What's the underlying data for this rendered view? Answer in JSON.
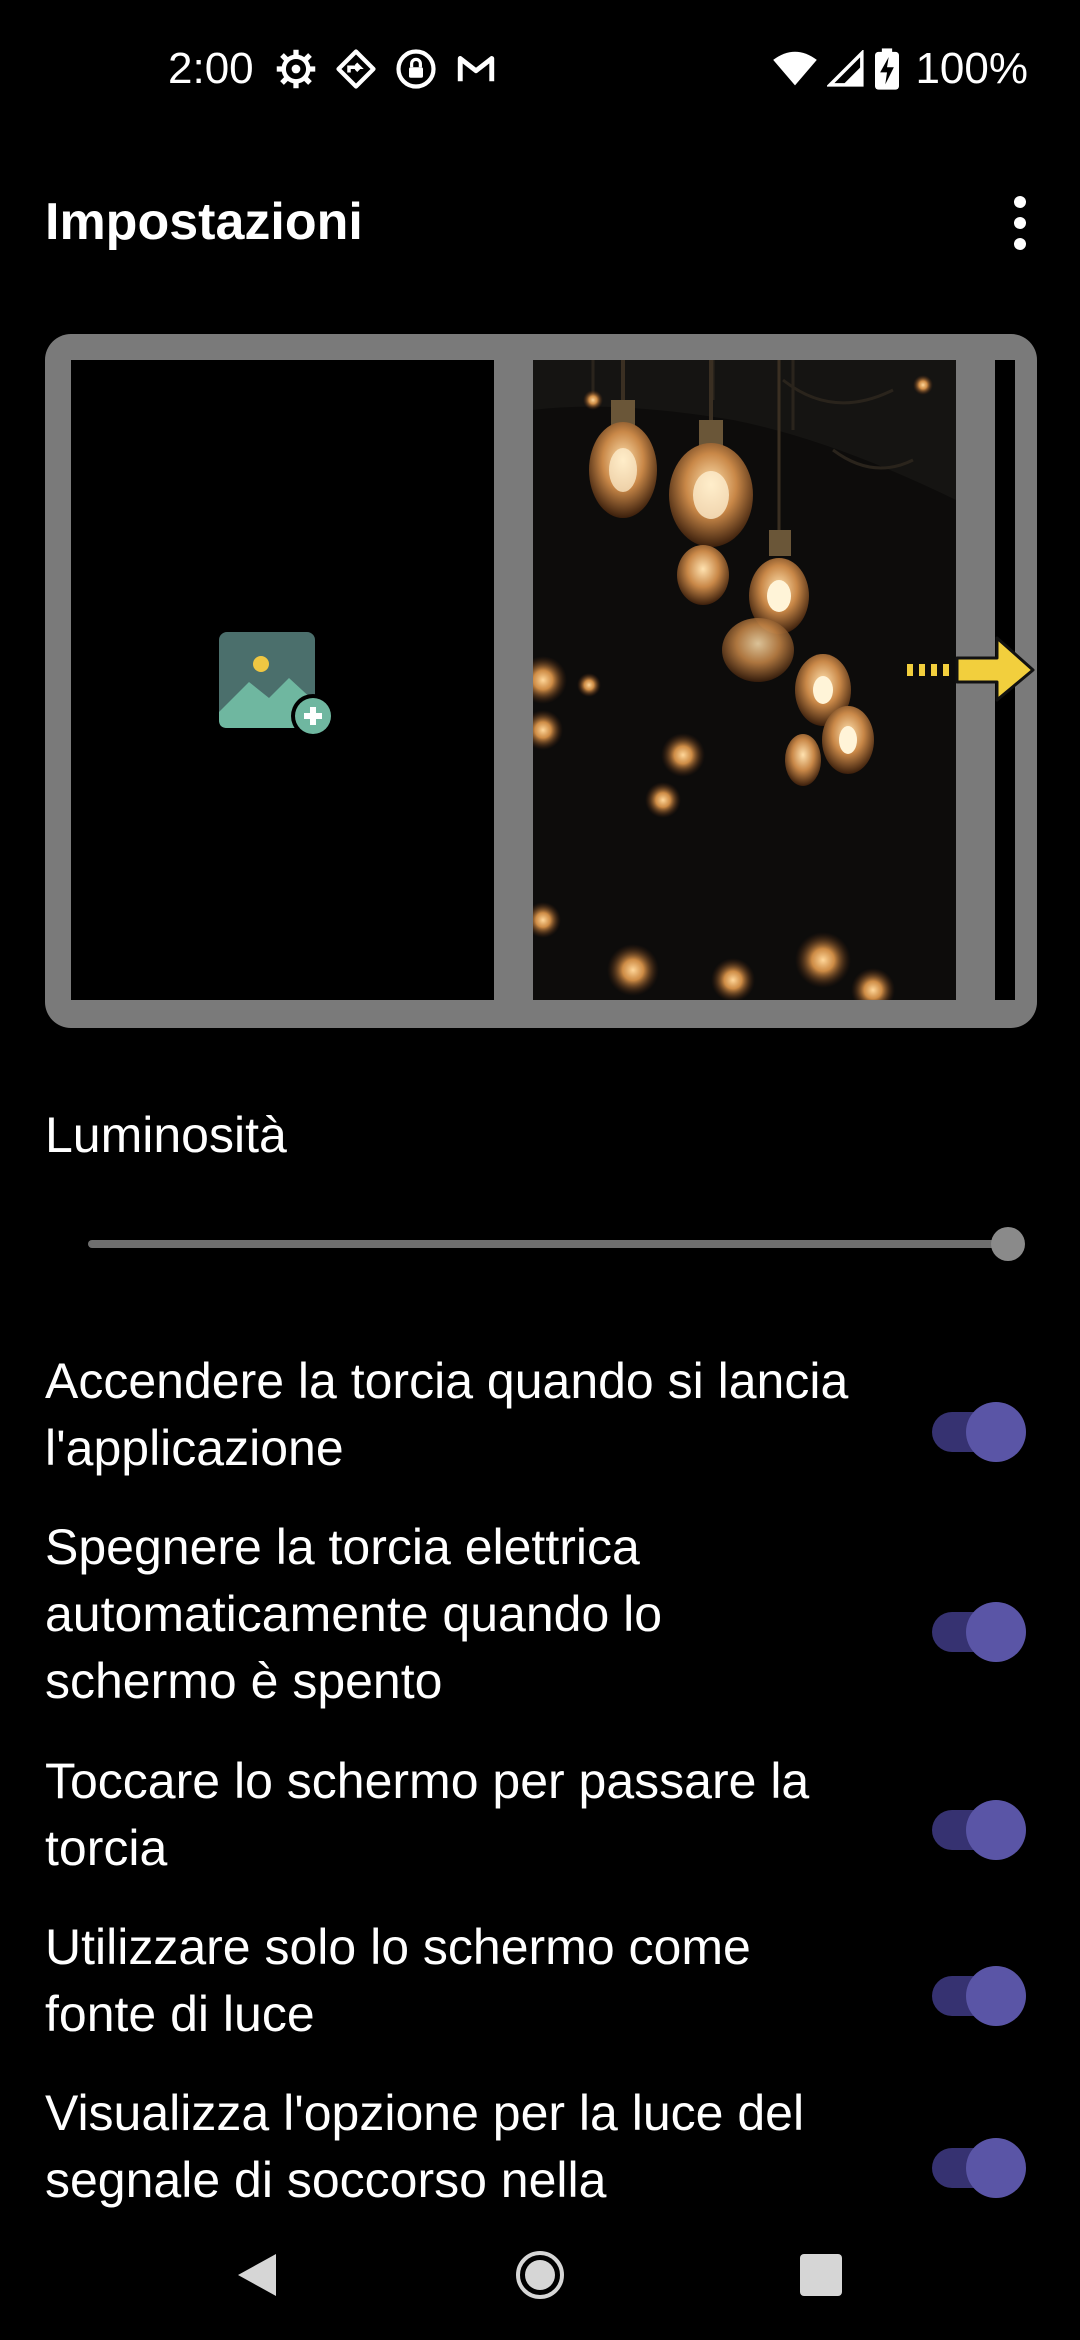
{
  "status_bar": {
    "time": "2:00",
    "icons": [
      "settings-gear-icon",
      "navigation-icon",
      "vpn-lock-icon",
      "gmail-icon"
    ],
    "right_icons": [
      "wifi-icon",
      "signal-icon",
      "battery-charging-icon"
    ],
    "battery": "100%"
  },
  "app_bar": {
    "title": "Impostazioni",
    "menu_icon": "more-vert-icon"
  },
  "preview": {
    "panels": [
      "add-image-icon",
      "light-bulbs-photo",
      "partial-panel"
    ],
    "arrow_icon": "swipe-right-arrow-icon"
  },
  "brightness": {
    "label": "Luminosità",
    "value_fraction": 1.0
  },
  "settings": [
    {
      "label": "Accendere la torcia quando si lancia l'applicazione",
      "enabled": true
    },
    {
      "label": "Spegnere la torcia elettrica automaticamente quando lo schermo è spento",
      "enabled": true
    },
    {
      "label": "Toccare lo schermo per passare la torcia",
      "enabled": true
    },
    {
      "label": "Utilizzare solo lo schermo come fonte di luce",
      "enabled": true
    },
    {
      "label": "Visualizza l'opzione per la luce del segnale di soccorso nella",
      "enabled": true
    }
  ],
  "colors": {
    "toggle_track": "#363271",
    "toggle_knob": "#5a55a6",
    "frame": "#7a7a7a",
    "arrow": "#f2cf3d"
  },
  "nav_bar": [
    "back-icon",
    "home-icon",
    "recents-icon"
  ]
}
